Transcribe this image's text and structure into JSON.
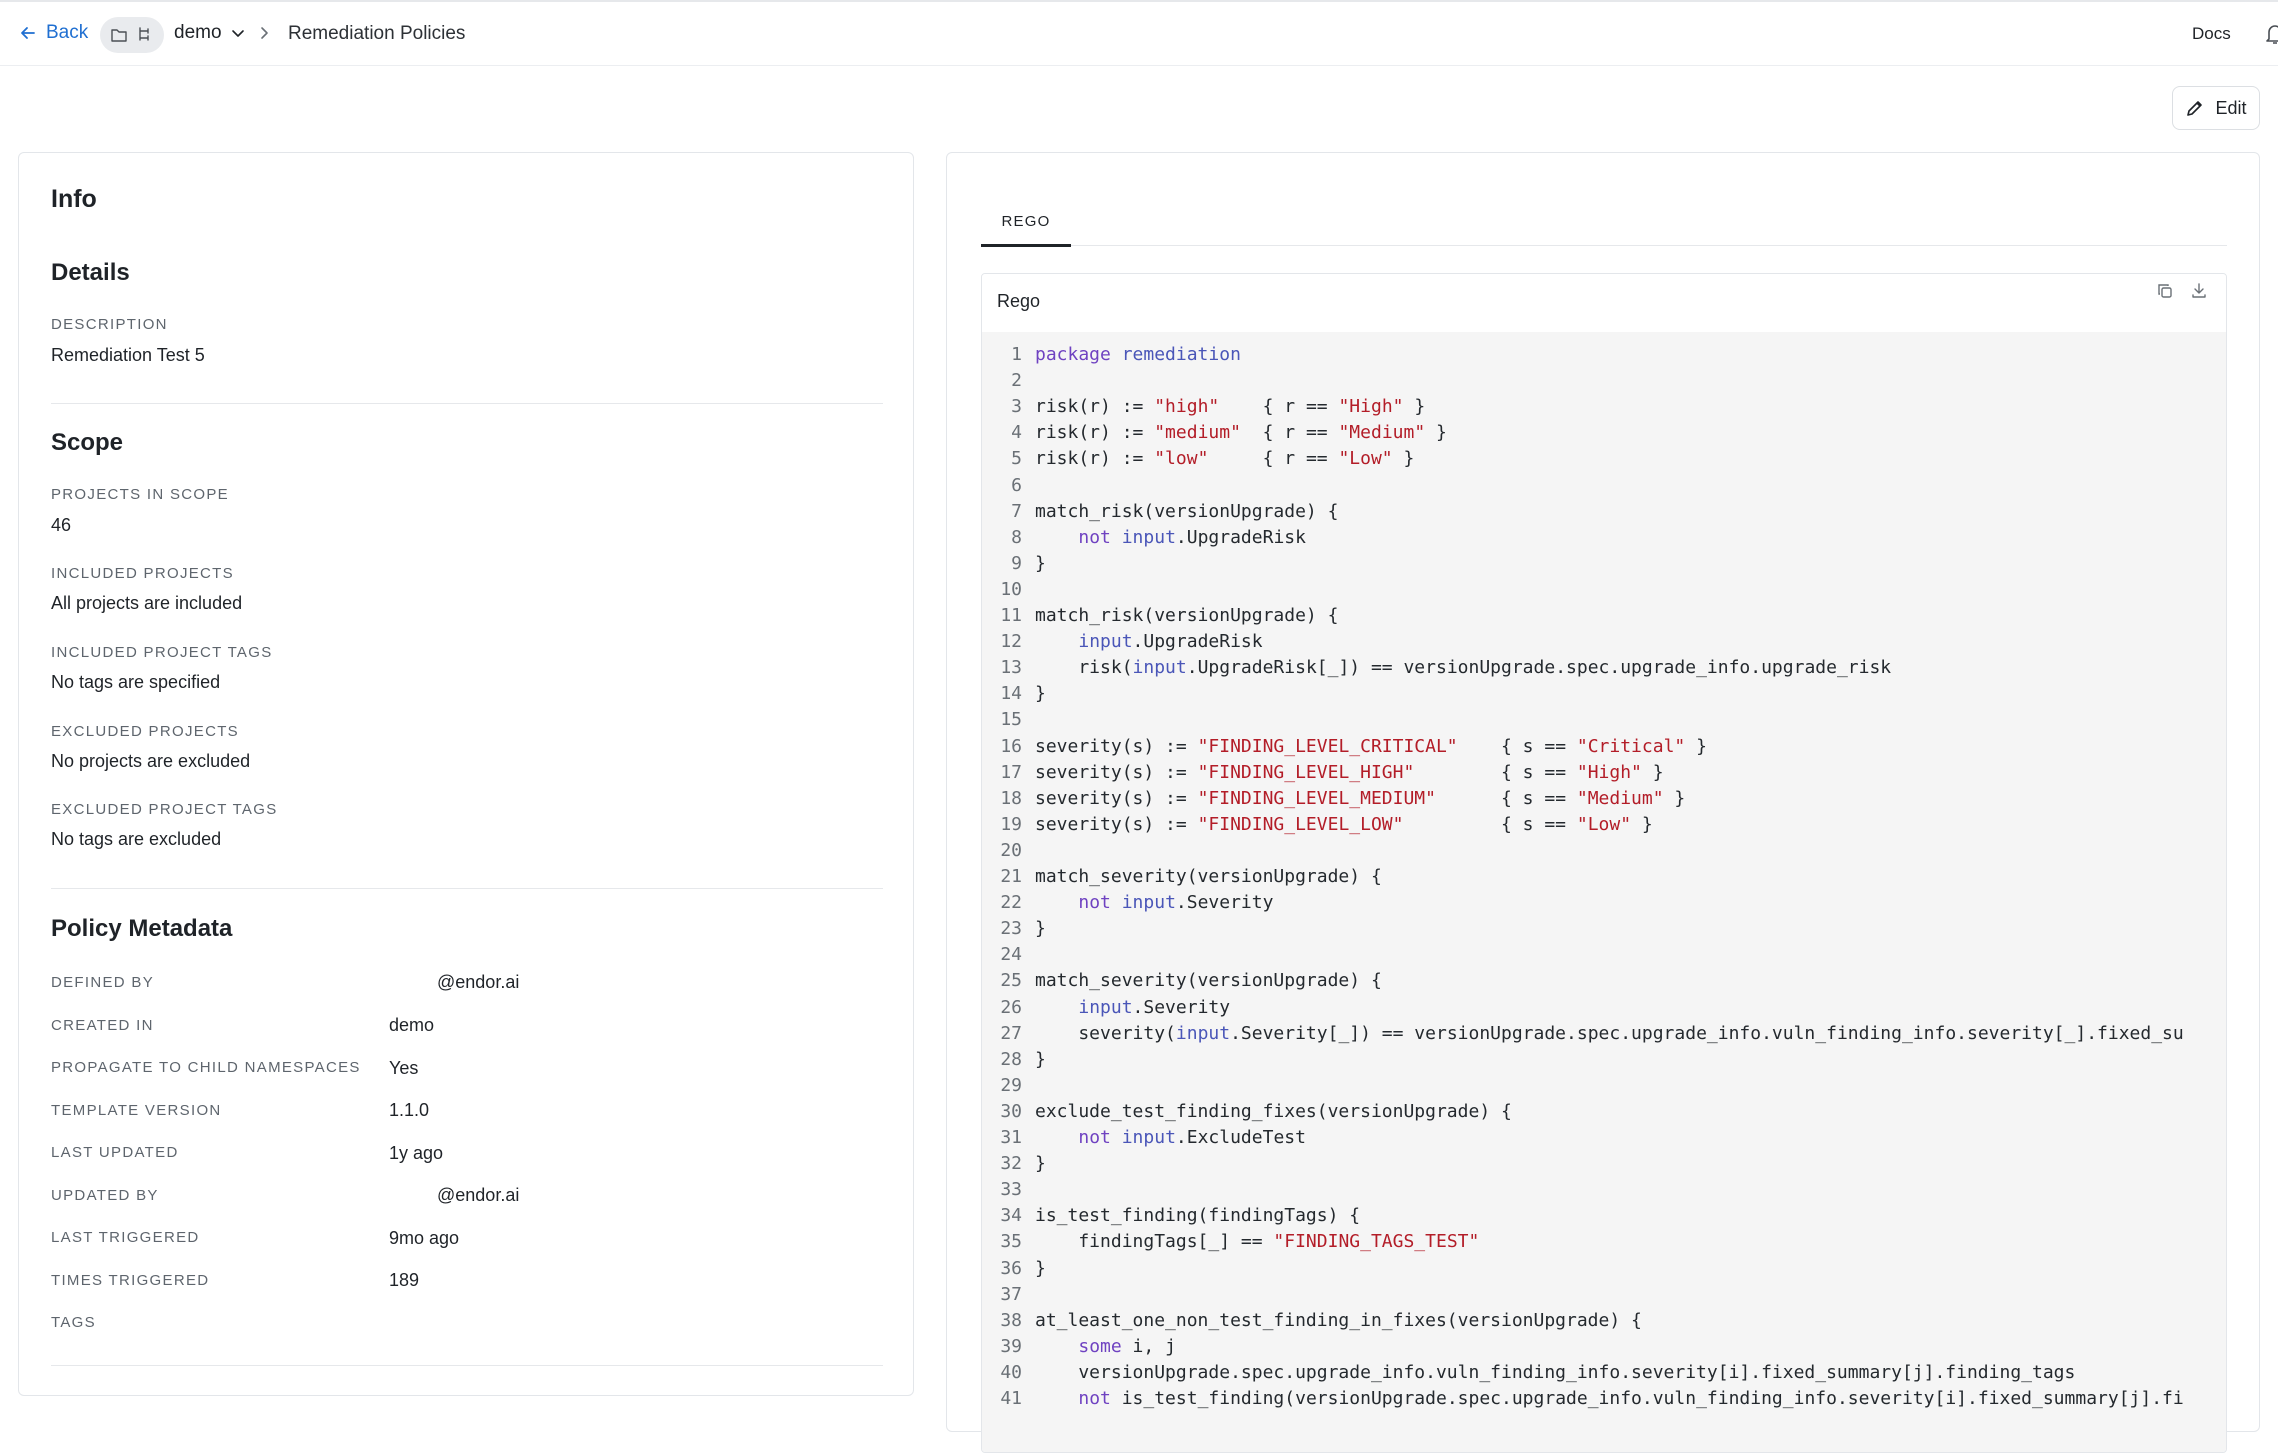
{
  "topbar": {
    "back_label": "Back",
    "namespace": "demo",
    "breadcrumb_current": "Remediation Policies",
    "docs_label": "Docs"
  },
  "edit_label": "Edit",
  "info": {
    "title": "Info",
    "details": {
      "heading": "Details",
      "description_label": "DESCRIPTION",
      "description_value": "Remediation Test 5"
    },
    "scope": {
      "heading": "Scope",
      "items": [
        {
          "label": "PROJECTS IN SCOPE",
          "value": "46"
        },
        {
          "label": "INCLUDED PROJECTS",
          "value": "All projects are included"
        },
        {
          "label": "INCLUDED PROJECT TAGS",
          "value": "No tags are specified"
        },
        {
          "label": "EXCLUDED PROJECTS",
          "value": "No projects are excluded"
        },
        {
          "label": "EXCLUDED PROJECT TAGS",
          "value": "No tags are excluded"
        }
      ]
    },
    "metadata": {
      "heading": "Policy Metadata",
      "items": [
        {
          "label": "DEFINED BY",
          "value": "@endor.ai"
        },
        {
          "label": "CREATED IN",
          "value": "demo"
        },
        {
          "label": "PROPAGATE TO CHILD NAMESPACES",
          "value": "Yes"
        },
        {
          "label": "TEMPLATE VERSION",
          "value": "1.1.0"
        },
        {
          "label": "LAST UPDATED",
          "value": "1y ago"
        },
        {
          "label": "UPDATED BY",
          "value": "@endor.ai"
        },
        {
          "label": "LAST TRIGGERED",
          "value": "9mo ago"
        },
        {
          "label": "TIMES TRIGGERED",
          "value": "189"
        },
        {
          "label": "TAGS",
          "value": ""
        }
      ]
    }
  },
  "rego": {
    "tab_label": "REGO",
    "panel_title": "Rego",
    "lines": [
      [
        [
          "kw",
          "package"
        ],
        [
          "t",
          " "
        ],
        [
          "bi",
          "remediation"
        ]
      ],
      [],
      [
        [
          "t",
          "risk(r) := "
        ],
        [
          "str",
          "\"high\""
        ],
        [
          "t",
          "    { r == "
        ],
        [
          "str",
          "\"High\""
        ],
        [
          "t",
          " }"
        ]
      ],
      [
        [
          "t",
          "risk(r) := "
        ],
        [
          "str",
          "\"medium\""
        ],
        [
          "t",
          "  { r == "
        ],
        [
          "str",
          "\"Medium\""
        ],
        [
          "t",
          " }"
        ]
      ],
      [
        [
          "t",
          "risk(r) := "
        ],
        [
          "str",
          "\"low\""
        ],
        [
          "t",
          "     { r == "
        ],
        [
          "str",
          "\"Low\""
        ],
        [
          "t",
          " }"
        ]
      ],
      [],
      [
        [
          "t",
          "match_risk(versionUpgrade) {"
        ]
      ],
      [
        [
          "t",
          "    "
        ],
        [
          "kw",
          "not"
        ],
        [
          "t",
          " "
        ],
        [
          "bi",
          "input"
        ],
        [
          "t",
          ".UpgradeRisk"
        ]
      ],
      [
        [
          "t",
          "}"
        ]
      ],
      [],
      [
        [
          "t",
          "match_risk(versionUpgrade) {"
        ]
      ],
      [
        [
          "t",
          "    "
        ],
        [
          "bi",
          "input"
        ],
        [
          "t",
          ".UpgradeRisk"
        ]
      ],
      [
        [
          "t",
          "    risk("
        ],
        [
          "bi",
          "input"
        ],
        [
          "t",
          ".UpgradeRisk[_]) == versionUpgrade.spec.upgrade_info.upgrade_risk"
        ]
      ],
      [
        [
          "t",
          "}"
        ]
      ],
      [],
      [
        [
          "t",
          "severity(s) := "
        ],
        [
          "str",
          "\"FINDING_LEVEL_CRITICAL\""
        ],
        [
          "t",
          "    { s == "
        ],
        [
          "str",
          "\"Critical\""
        ],
        [
          "t",
          " }"
        ]
      ],
      [
        [
          "t",
          "severity(s) := "
        ],
        [
          "str",
          "\"FINDING_LEVEL_HIGH\""
        ],
        [
          "t",
          "        { s == "
        ],
        [
          "str",
          "\"High\""
        ],
        [
          "t",
          " }"
        ]
      ],
      [
        [
          "t",
          "severity(s) := "
        ],
        [
          "str",
          "\"FINDING_LEVEL_MEDIUM\""
        ],
        [
          "t",
          "      { s == "
        ],
        [
          "str",
          "\"Medium\""
        ],
        [
          "t",
          " }"
        ]
      ],
      [
        [
          "t",
          "severity(s) := "
        ],
        [
          "str",
          "\"FINDING_LEVEL_LOW\""
        ],
        [
          "t",
          "         { s == "
        ],
        [
          "str",
          "\"Low\""
        ],
        [
          "t",
          " }"
        ]
      ],
      [],
      [
        [
          "t",
          "match_severity(versionUpgrade) {"
        ]
      ],
      [
        [
          "t",
          "    "
        ],
        [
          "kw",
          "not"
        ],
        [
          "t",
          " "
        ],
        [
          "bi",
          "input"
        ],
        [
          "t",
          ".Severity"
        ]
      ],
      [
        [
          "t",
          "}"
        ]
      ],
      [],
      [
        [
          "t",
          "match_severity(versionUpgrade) {"
        ]
      ],
      [
        [
          "t",
          "    "
        ],
        [
          "bi",
          "input"
        ],
        [
          "t",
          ".Severity"
        ]
      ],
      [
        [
          "t",
          "    severity("
        ],
        [
          "bi",
          "input"
        ],
        [
          "t",
          ".Severity[_]) == versionUpgrade.spec.upgrade_info.vuln_finding_info.severity[_].fixed_su"
        ]
      ],
      [
        [
          "t",
          "}"
        ]
      ],
      [],
      [
        [
          "t",
          "exclude_test_finding_fixes(versionUpgrade) {"
        ]
      ],
      [
        [
          "t",
          "    "
        ],
        [
          "kw",
          "not"
        ],
        [
          "t",
          " "
        ],
        [
          "bi",
          "input"
        ],
        [
          "t",
          ".ExcludeTest"
        ]
      ],
      [
        [
          "t",
          "}"
        ]
      ],
      [],
      [
        [
          "t",
          "is_test_finding(findingTags) {"
        ]
      ],
      [
        [
          "t",
          "    findingTags[_] == "
        ],
        [
          "str",
          "\"FINDING_TAGS_TEST\""
        ]
      ],
      [
        [
          "t",
          "}"
        ]
      ],
      [],
      [
        [
          "t",
          "at_least_one_non_test_finding_in_fixes(versionUpgrade) {"
        ]
      ],
      [
        [
          "t",
          "    "
        ],
        [
          "kw",
          "some"
        ],
        [
          "t",
          " i, j"
        ]
      ],
      [
        [
          "t",
          "    versionUpgrade.spec.upgrade_info.vuln_finding_info.severity[i].fixed_summary[j].finding_tags"
        ]
      ],
      [
        [
          "t",
          "    "
        ],
        [
          "kw",
          "not"
        ],
        [
          "t",
          " is_test_finding(versionUpgrade.spec.upgrade_info.vuln_finding_info.severity[i].fixed_summary[j].fi"
        ]
      ]
    ]
  }
}
